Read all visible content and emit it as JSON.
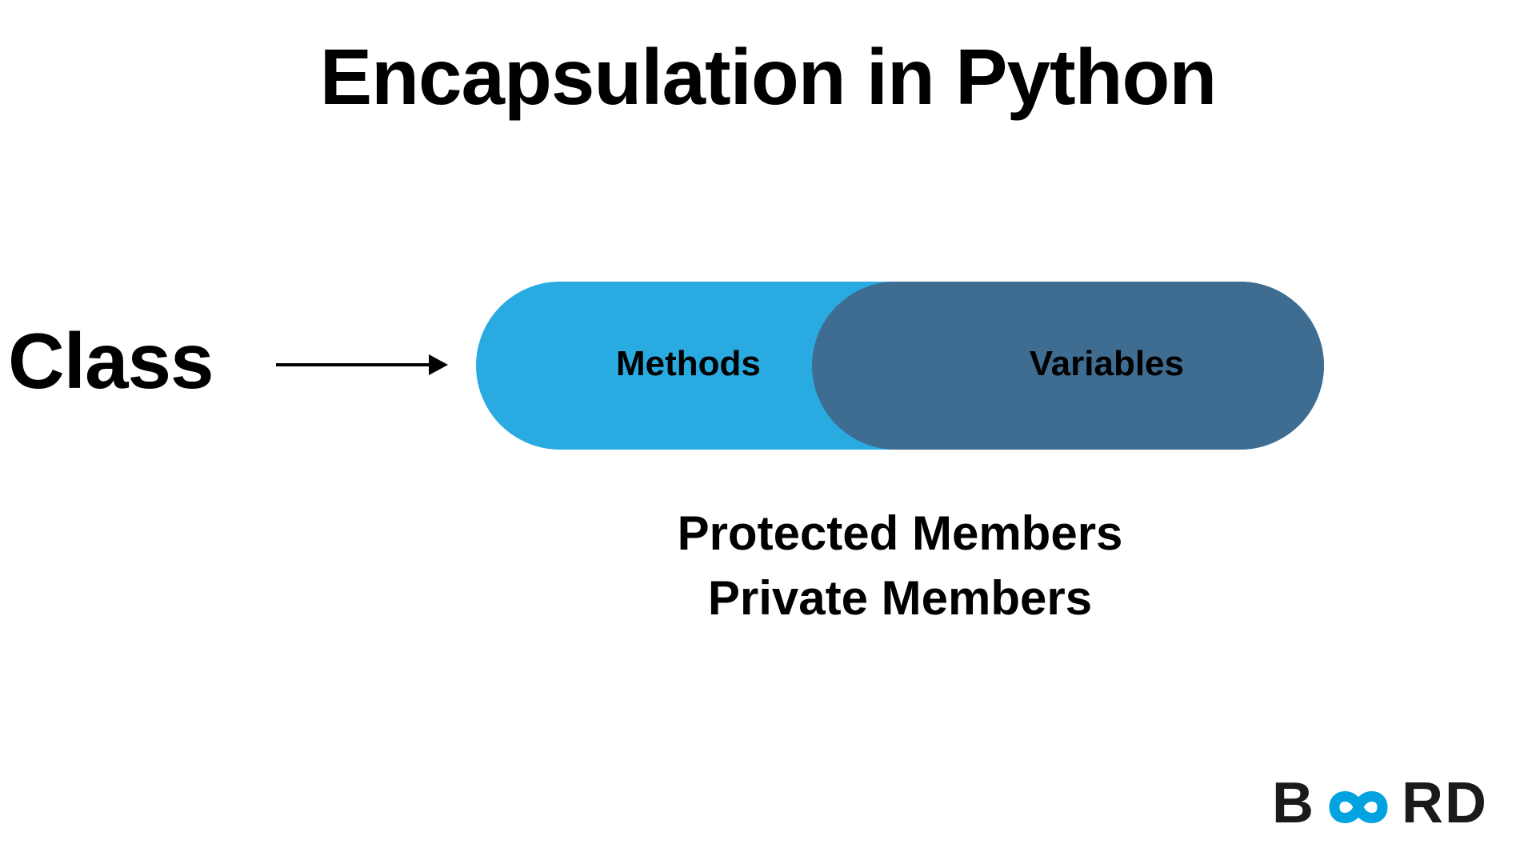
{
  "title": "Encapsulation in Python",
  "class_label": "Class",
  "pill": {
    "left_label": "Methods",
    "right_label": "Variables"
  },
  "members": {
    "line1": "Protected Members",
    "line2": "Private Members"
  },
  "colors": {
    "pill_left": "#29abe2",
    "pill_right": "#3f6c91",
    "logo_infinity": "#00a3e0"
  },
  "logo": {
    "part1": "B",
    "part2": "RD"
  }
}
